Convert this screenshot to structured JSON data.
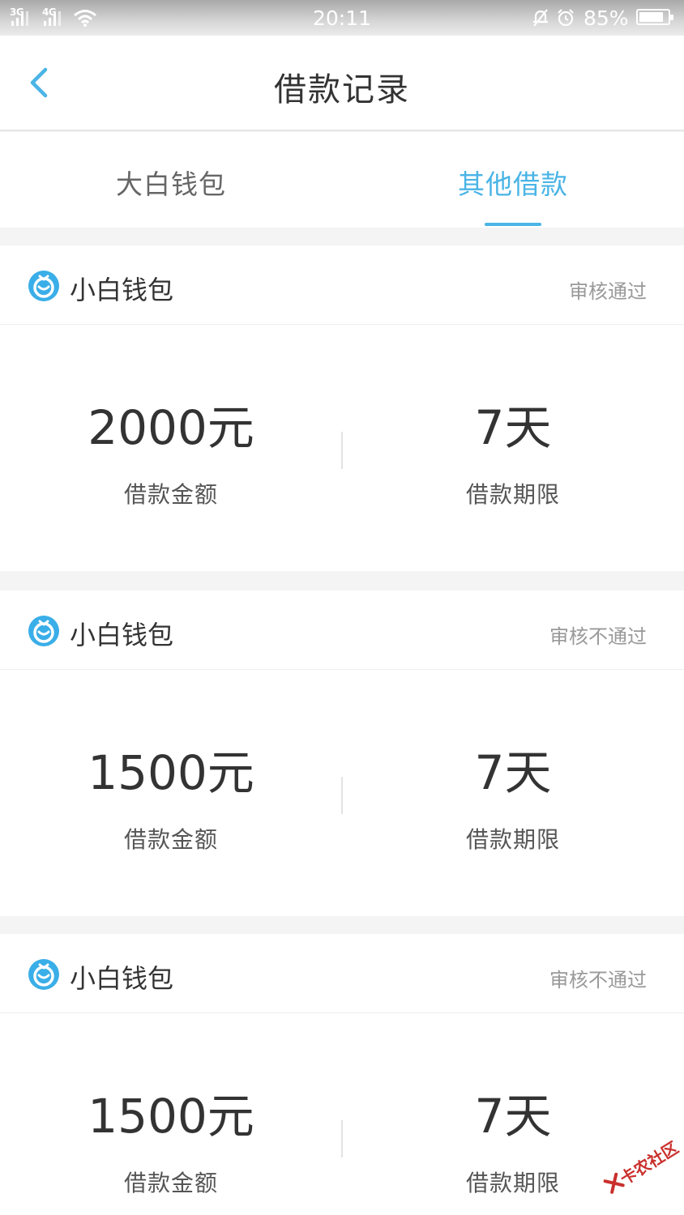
{
  "status_bar": {
    "signal_1": "3G",
    "signal_2": "4G",
    "time": "20:11",
    "battery_text": "85%",
    "battery_level_percent": 85
  },
  "header": {
    "title": "借款记录"
  },
  "tabs": [
    {
      "label": "大白钱包",
      "active": false
    },
    {
      "label": "其他借款",
      "active": true
    }
  ],
  "colors": {
    "accent": "#4ab4e6",
    "text_primary": "#333333",
    "text_secondary": "#555555",
    "status_text": "#999999",
    "inactive_tab": "#666666"
  },
  "records": [
    {
      "app_name": "小白钱包",
      "logo_icon": "xiaobai-wallet-icon",
      "status": "审核通过",
      "amount": "2000元",
      "amount_label": "借款金额",
      "term": "7天",
      "term_label": "借款期限"
    },
    {
      "app_name": "小白钱包",
      "logo_icon": "xiaobai-wallet-icon",
      "status": "审核不通过",
      "amount": "1500元",
      "amount_label": "借款金额",
      "term": "7天",
      "term_label": "借款期限"
    },
    {
      "app_name": "小白钱包",
      "logo_icon": "xiaobai-wallet-icon",
      "status": "审核不通过",
      "amount": "1500元",
      "amount_label": "借款金额",
      "term": "7天",
      "term_label": "借款期限"
    }
  ],
  "watermark": {
    "text": "卡农社区"
  }
}
